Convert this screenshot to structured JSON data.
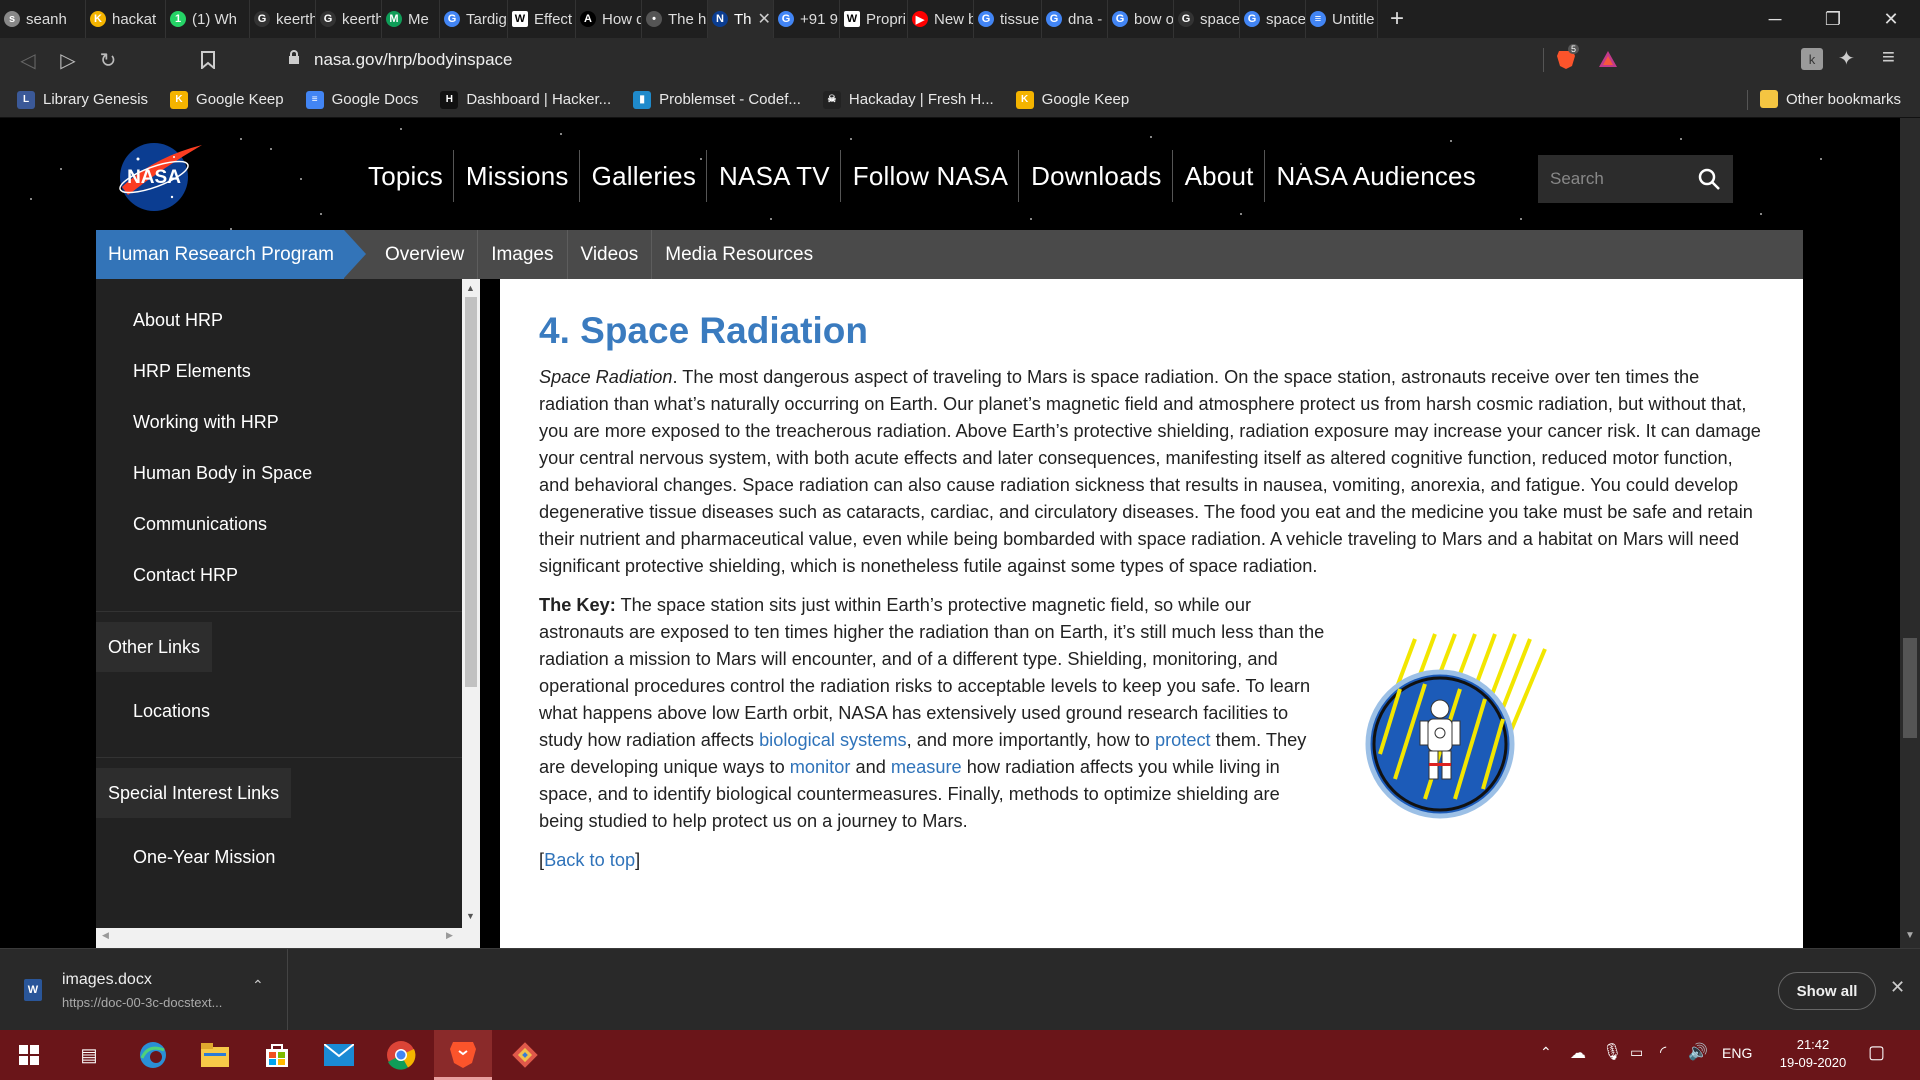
{
  "browser": {
    "tabs": [
      {
        "label": "seanh",
        "favicon_color": "#888888",
        "favicon_glyph": "s"
      },
      {
        "label": "hackat",
        "favicon_color": "#f4b400",
        "favicon_glyph": "K"
      },
      {
        "label": "(1) Wh",
        "favicon_color": "#25d366",
        "favicon_glyph": "1"
      },
      {
        "label": "keerth",
        "favicon_color": "#333333",
        "favicon_glyph": "G"
      },
      {
        "label": "keerth",
        "favicon_color": "#333333",
        "favicon_glyph": "G"
      },
      {
        "label": "Me",
        "favicon_color": "#0f9d58",
        "favicon_glyph": "M"
      },
      {
        "label": "Tardig",
        "favicon_color": "#4285f4",
        "favicon_glyph": "G"
      },
      {
        "label": "Effect",
        "favicon_color": "#ffffff",
        "favicon_glyph": "W"
      },
      {
        "label": "How d",
        "favicon_color": "#000000",
        "favicon_glyph": "A"
      },
      {
        "label": "The hu",
        "favicon_color": "#555555",
        "favicon_glyph": "•"
      },
      {
        "label": "Th",
        "favicon_color": "#0b3d91",
        "favicon_glyph": "N"
      },
      {
        "label": "+91 9",
        "favicon_color": "#4285f4",
        "favicon_glyph": "G"
      },
      {
        "label": "Propri",
        "favicon_color": "#ffffff",
        "favicon_glyph": "W"
      },
      {
        "label": "New b",
        "favicon_color": "#ff0000",
        "favicon_glyph": "▶"
      },
      {
        "label": "tissue",
        "favicon_color": "#4285f4",
        "favicon_glyph": "G"
      },
      {
        "label": "dna -",
        "favicon_color": "#4285f4",
        "favicon_glyph": "G"
      },
      {
        "label": "bow o",
        "favicon_color": "#4285f4",
        "favicon_glyph": "G"
      },
      {
        "label": "space",
        "favicon_color": "#333333",
        "favicon_glyph": "G"
      },
      {
        "label": "space",
        "favicon_color": "#4285f4",
        "favicon_glyph": "G"
      },
      {
        "label": "Untitle",
        "favicon_color": "#4285f4",
        "favicon_glyph": "≡"
      }
    ],
    "active_tab_index": 10,
    "url": "nasa.gov/hrp/bodyinspace",
    "brave_badge": "5",
    "bookmarks": [
      {
        "label": "Library Genesis",
        "color": "#3b5998",
        "glyph": "L"
      },
      {
        "label": "Google Keep",
        "color": "#f4b400",
        "glyph": "K"
      },
      {
        "label": "Google Docs",
        "color": "#4285f4",
        "glyph": "≡"
      },
      {
        "label": "Dashboard | Hacker...",
        "color": "#111111",
        "glyph": "H"
      },
      {
        "label": "Problemset - Codef...",
        "color": "#1f8acb",
        "glyph": "▮"
      },
      {
        "label": "Hackaday | Fresh H...",
        "color": "#222222",
        "glyph": "☠"
      },
      {
        "label": "Google Keep",
        "color": "#f4b400",
        "glyph": "K"
      }
    ],
    "other_bookmarks": "Other bookmarks"
  },
  "site": {
    "logo_text": "NASA",
    "nav": [
      "Topics",
      "Missions",
      "Galleries",
      "NASA TV",
      "Follow NASA",
      "Downloads",
      "About",
      "NASA Audiences"
    ],
    "search_placeholder": "Search",
    "program_tab": "Human Research Program",
    "subnav": [
      "Overview",
      "Images",
      "Videos",
      "Media Resources"
    ],
    "sidebar": {
      "items": [
        "About HRP",
        "HRP Elements",
        "Working with HRP",
        "Human Body in Space",
        "Communications",
        "Contact HRP"
      ],
      "other_links_heading": "Other Links",
      "other_links": [
        "Locations"
      ],
      "special_heading": "Special Interest Links",
      "special_links": [
        "One-Year Mission"
      ]
    }
  },
  "article": {
    "heading": "4. Space Radiation",
    "p1_lead": "Space Radiation",
    "p1_body": ". The most dangerous aspect of traveling to Mars is space radiation. On the space station, astronauts receive over ten times the radiation than what’s naturally occurring on Earth. Our planet’s magnetic field and atmosphere protect us from harsh cosmic radiation, but without that, you are more exposed to the treacherous radiation. Above Earth’s protective shielding, radiation exposure may increase your cancer risk. It can damage your central nervous system, with both acute effects and later consequences, manifesting itself as altered cognitive function, reduced motor function, and behavioral changes. Space radiation can also cause radiation sickness that results in nausea, vomiting, anorexia, and fatigue. You could develop degenerative tissue diseases such as cataracts, cardiac, and circulatory diseases. The food you eat and the medicine you take must be safe and retain their nutrient and pharmaceutical value, even while being bombarded with space radiation. A vehicle traveling to Mars and a habitat on Mars will need significant protective shielding, which is nonetheless futile against some types of space radiation.",
    "key_lead": "The Key:",
    "key_part1": " The space station sits just within Earth’s protective magnetic field, so while our astronauts are exposed to ten times higher the radiation than on Earth, it’s still much less than the radiation a mission to Mars will encounter, and of a different type. Shielding, monitoring, and operational procedures control the radiation risks to acceptable levels to keep you safe. To learn what happens above low Earth orbit, NASA has extensively used ground research facilities to study how radiation affects ",
    "link_bio": "biological systems",
    "key_part2": ", and more importantly, how to ",
    "link_protect": "protect",
    "key_part3": " them. They are developing unique ways to ",
    "link_monitor": "monitor",
    "key_part4": " and ",
    "link_measure": "measure",
    "key_part5": " how radiation affects you while living in space, and to identify biological countermeasures. Finally, methods to optimize shielding are being studied to help protect us on a journey to Mars.",
    "back_to_top": "Back to top"
  },
  "downloads": {
    "filename": "images.docx",
    "source": "https://doc-00-3c-docstext...",
    "show_all": "Show all"
  },
  "taskbar": {
    "language": "ENG",
    "time": "21:42",
    "date": "19-09-2020"
  },
  "colors": {
    "accent_blue": "#3374b8",
    "heading_blue": "#3a7bbf",
    "link_blue": "#2f73ba",
    "taskbar": "#6a1519"
  }
}
